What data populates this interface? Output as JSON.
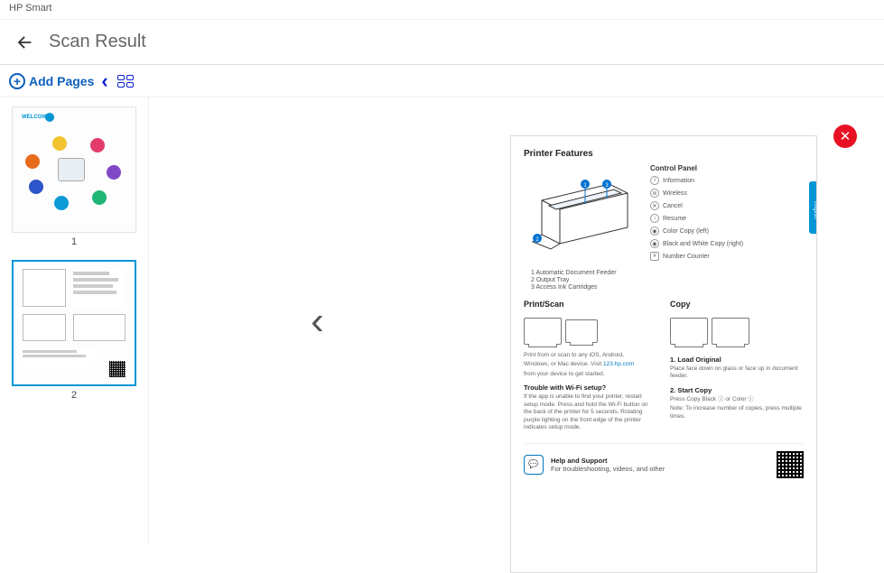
{
  "app_title": "HP Smart",
  "page_title": "Scan Result",
  "toolbar": {
    "add_pages_label": "Add Pages"
  },
  "thumbnails": [
    {
      "number": "1",
      "selected": false
    },
    {
      "number": "2",
      "selected": true
    }
  ],
  "preview": {
    "close_label": "✕",
    "prev_label": "‹",
    "lang_tab": "English"
  },
  "doc": {
    "section_features": "Printer Features",
    "control_panel_title": "Control Panel",
    "cp_items": {
      "info": "Information",
      "wireless": "Wireless",
      "cancel": "Cancel",
      "resume": "Resume",
      "color_copy": "Color Copy (left)",
      "bw_copy": "Black and White Copy (right)",
      "counter": "Number Counter"
    },
    "callouts": {
      "c1": "1   Automatic Document Feeder",
      "c2": "2   Output Tray",
      "c3": "3   Access Ink Cartridges"
    },
    "print_scan_title": "Print/Scan",
    "print_scan_text1": "Print from or scan to any iOS, Android,",
    "print_scan_text2": "Windows, or Mac device. Visit ",
    "print_scan_link": "123.hp.com",
    "print_scan_text3": "from your device to get started.",
    "wifi_title": "Trouble with Wi-Fi setup?",
    "wifi_text": "If the app is unable to find your printer, restart setup mode. Press and hold the Wi-Fi button on the back of the printer for 5 seconds. Rotating purple lighting on the front edge of the printer indicates setup mode.",
    "copy_title": "Copy",
    "copy_step1_title": "1. Load Original",
    "copy_step1_text": "Place face down on glass or face up in document feeder.",
    "copy_step2_title": "2. Start Copy",
    "copy_step2_text": "Press Copy Black ⓘ or Color ⓘ",
    "copy_note": "Note: To increase number of copies, press multiple times.",
    "help_title": "Help and Support",
    "help_text": "For troubleshooting, videos, and other"
  }
}
